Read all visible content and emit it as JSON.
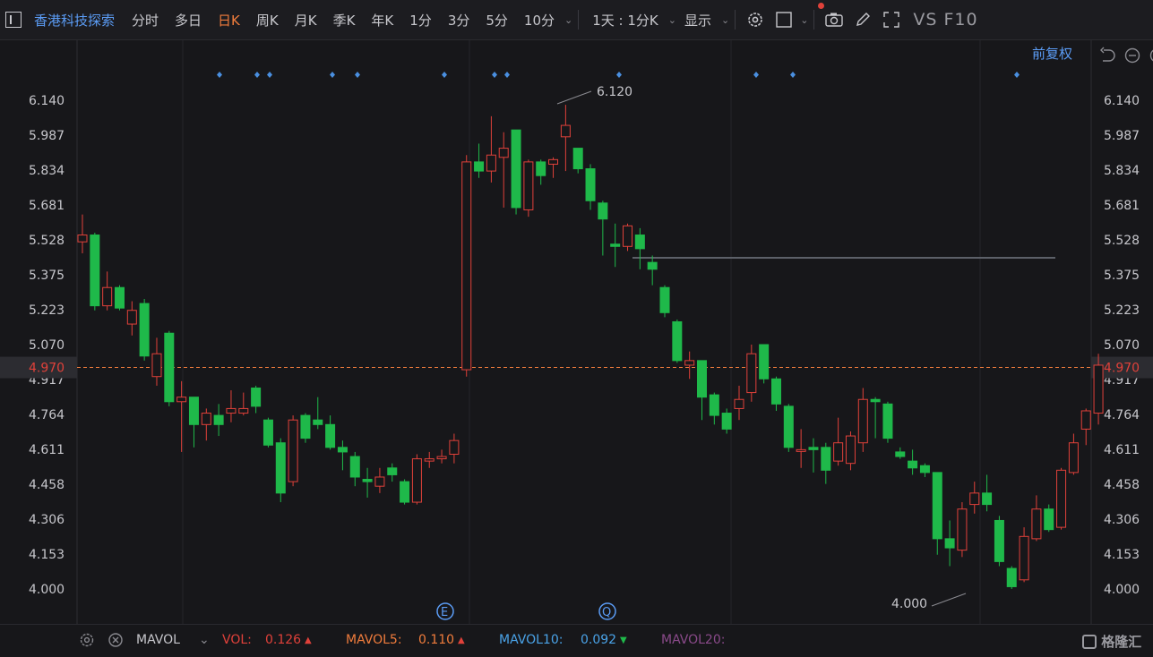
{
  "toolbar": {
    "stock_name": "香港科技探索",
    "tabs": [
      {
        "label": "分时",
        "active": false
      },
      {
        "label": "多日",
        "active": false
      },
      {
        "label": "日K",
        "active": true
      },
      {
        "label": "周K",
        "active": false
      },
      {
        "label": "月K",
        "active": false
      },
      {
        "label": "季K",
        "active": false
      },
      {
        "label": "年K",
        "active": false
      },
      {
        "label": "1分",
        "active": false
      },
      {
        "label": "3分",
        "active": false
      },
      {
        "label": "5分",
        "active": false
      },
      {
        "label": "10分",
        "active": false
      }
    ],
    "interval_label": "1天 : 1分K",
    "display_label": "显示",
    "vs_label": "VS F10"
  },
  "chart_top_right": {
    "adjust_label": "前复权"
  },
  "axis": {
    "ticks": [
      "6.140",
      "5.987",
      "5.834",
      "5.681",
      "5.528",
      "5.375",
      "5.223",
      "5.070",
      "4.917",
      "4.764",
      "4.611",
      "4.458",
      "4.306",
      "4.153",
      "4.000"
    ],
    "current_price": "4.970"
  },
  "annotations": {
    "high_label": "6.120",
    "low_label": "4.000",
    "event_e": "E",
    "event_q": "Q"
  },
  "bottom": {
    "indicator": "MAVOL",
    "vol_label": "VOL:",
    "vol_value": "0.126",
    "mavol5_label": "MAVOL5:",
    "mavol5_value": "0.110",
    "mavol10_label": "MAVOL10:",
    "mavol10_value": "0.092",
    "mavol20_label": "MAVOL20:"
  },
  "watermark": "格隆汇",
  "colors": {
    "up": "#e0413a",
    "down": "#1fb94a",
    "accent": "#f07c3c",
    "link": "#5b9cf5",
    "bg": "#17171a"
  },
  "chart_data": {
    "type": "candlestick",
    "ylim": [
      3.95,
      6.2
    ],
    "reference_line": 4.97,
    "resistance_line": 5.45,
    "candles": [
      [
        5.52,
        5.55,
        5.64,
        5.47
      ],
      [
        5.55,
        5.24,
        5.56,
        5.22
      ],
      [
        5.24,
        5.32,
        5.39,
        5.22
      ],
      [
        5.32,
        5.23,
        5.33,
        5.22
      ],
      [
        5.16,
        5.22,
        5.26,
        5.11
      ],
      [
        5.25,
        5.02,
        5.27,
        5.0
      ],
      [
        4.93,
        5.03,
        5.1,
        4.89
      ],
      [
        5.12,
        4.82,
        5.13,
        4.8
      ],
      [
        4.82,
        4.84,
        4.91,
        4.6
      ],
      [
        4.84,
        4.72,
        4.84,
        4.62
      ],
      [
        4.72,
        4.77,
        4.79,
        4.65
      ],
      [
        4.76,
        4.72,
        4.81,
        4.67
      ],
      [
        4.77,
        4.79,
        4.87,
        4.73
      ],
      [
        4.77,
        4.79,
        4.86,
        4.76
      ],
      [
        4.88,
        4.8,
        4.89,
        4.77
      ],
      [
        4.74,
        4.63,
        4.75,
        4.62
      ],
      [
        4.64,
        4.42,
        4.66,
        4.38
      ],
      [
        4.47,
        4.74,
        4.76,
        4.45
      ],
      [
        4.76,
        4.66,
        4.77,
        4.64
      ],
      [
        4.74,
        4.72,
        4.84,
        4.7
      ],
      [
        4.72,
        4.62,
        4.76,
        4.61
      ],
      [
        4.62,
        4.6,
        4.65,
        4.52
      ],
      [
        4.58,
        4.49,
        4.6,
        4.45
      ],
      [
        4.48,
        4.47,
        4.53,
        4.4
      ],
      [
        4.45,
        4.49,
        4.53,
        4.42
      ],
      [
        4.53,
        4.5,
        4.55,
        4.47
      ],
      [
        4.47,
        4.38,
        4.48,
        4.37
      ],
      [
        4.38,
        4.57,
        4.59,
        4.37
      ],
      [
        4.56,
        4.57,
        4.6,
        4.53
      ],
      [
        4.57,
        4.58,
        4.61,
        4.55
      ],
      [
        4.59,
        4.65,
        4.68,
        4.55
      ],
      [
        4.96,
        5.87,
        5.9,
        4.93
      ],
      [
        5.87,
        5.83,
        5.95,
        5.8
      ],
      [
        5.83,
        5.9,
        6.07,
        5.78
      ],
      [
        5.89,
        5.93,
        6.0,
        5.67
      ],
      [
        6.01,
        5.67,
        6.01,
        5.64
      ],
      [
        5.66,
        5.87,
        5.88,
        5.63
      ],
      [
        5.87,
        5.81,
        5.88,
        5.77
      ],
      [
        5.86,
        5.88,
        5.89,
        5.8
      ],
      [
        5.98,
        6.03,
        6.12,
        5.83
      ],
      [
        5.93,
        5.84,
        5.93,
        5.82
      ],
      [
        5.84,
        5.7,
        5.86,
        5.66
      ],
      [
        5.69,
        5.62,
        5.7,
        5.46
      ],
      [
        5.51,
        5.5,
        5.6,
        5.41
      ],
      [
        5.5,
        5.59,
        5.6,
        5.48
      ],
      [
        5.55,
        5.49,
        5.58,
        5.4
      ],
      [
        5.43,
        5.4,
        5.46,
        5.33
      ],
      [
        5.32,
        5.21,
        5.33,
        5.19
      ],
      [
        5.17,
        5.0,
        5.18,
        4.99
      ],
      [
        4.98,
        5.0,
        5.04,
        4.92
      ],
      [
        5.0,
        4.84,
        5.0,
        4.74
      ],
      [
        4.85,
        4.76,
        4.86,
        4.72
      ],
      [
        4.77,
        4.7,
        4.79,
        4.68
      ],
      [
        4.79,
        4.83,
        4.89,
        4.74
      ],
      [
        4.86,
        5.03,
        5.07,
        4.82
      ],
      [
        5.07,
        4.92,
        5.07,
        4.9
      ],
      [
        4.92,
        4.81,
        4.93,
        4.78
      ],
      [
        4.8,
        4.62,
        4.81,
        4.6
      ],
      [
        4.61,
        4.61,
        4.7,
        4.53
      ],
      [
        4.62,
        4.61,
        4.66,
        4.51
      ],
      [
        4.62,
        4.52,
        4.64,
        4.46
      ],
      [
        4.56,
        4.64,
        4.75,
        4.54
      ],
      [
        4.55,
        4.67,
        4.69,
        4.52
      ],
      [
        4.64,
        4.83,
        4.88,
        4.6
      ],
      [
        4.83,
        4.82,
        4.84,
        4.66
      ],
      [
        4.81,
        4.66,
        4.82,
        4.64
      ],
      [
        4.6,
        4.58,
        4.62,
        4.57
      ],
      [
        4.56,
        4.53,
        4.61,
        4.5
      ],
      [
        4.54,
        4.51,
        4.55,
        4.49
      ],
      [
        4.51,
        4.22,
        4.51,
        4.15
      ],
      [
        4.22,
        4.18,
        4.3,
        4.1
      ],
      [
        4.17,
        4.35,
        4.38,
        4.14
      ],
      [
        4.37,
        4.42,
        4.47,
        4.33
      ],
      [
        4.42,
        4.37,
        4.5,
        4.34
      ],
      [
        4.3,
        4.12,
        4.32,
        4.1
      ],
      [
        4.09,
        4.01,
        4.1,
        4.0
      ],
      [
        4.04,
        4.23,
        4.27,
        4.03
      ],
      [
        4.22,
        4.35,
        4.41,
        4.21
      ],
      [
        4.35,
        4.26,
        4.37,
        4.25
      ],
      [
        4.27,
        4.52,
        4.53,
        4.26
      ],
      [
        4.51,
        4.64,
        4.68,
        4.5
      ],
      [
        4.7,
        4.78,
        4.79,
        4.63
      ],
      [
        4.77,
        4.98,
        5.03,
        4.72
      ]
    ],
    "x_start": 92,
    "x_step": 13.83
  }
}
